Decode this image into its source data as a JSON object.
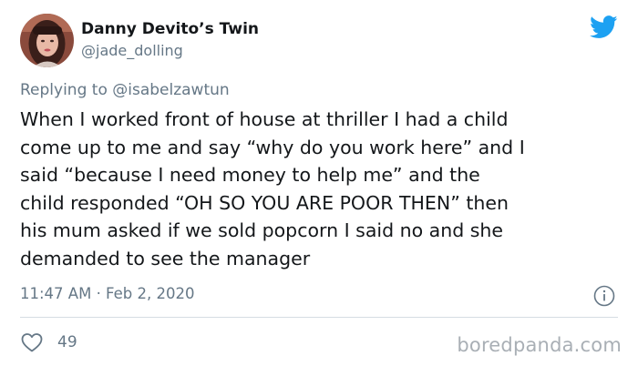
{
  "author": {
    "display_name": "Danny Devito’s Twin",
    "handle": "@jade_dolling"
  },
  "reply_context": {
    "prefix": "Replying to ",
    "mention": "@isabelzawtun"
  },
  "tweet": {
    "lines": [
      "When I worked front of house at thriller I had a child",
      "come up to me and say “why do you work here” and I",
      "said “because I need money to help me” and the",
      "child responded “OH SO YOU ARE POOR THEN” then",
      "his mum asked if we sold popcorn I said no and she",
      "demanded to see the manager"
    ],
    "timestamp": "11:47 AM · Feb 2, 2020",
    "likes": "49"
  },
  "watermark": "boredpanda.com",
  "icons": {
    "brand": "twitter-bird-icon",
    "info": "info-icon",
    "like": "heart-icon"
  },
  "colors": {
    "twitter_blue": "#1da1f2",
    "secondary_text": "#657786",
    "primary_text": "#14171a",
    "divider": "#d6dde3",
    "watermark": "#a9afb5"
  }
}
